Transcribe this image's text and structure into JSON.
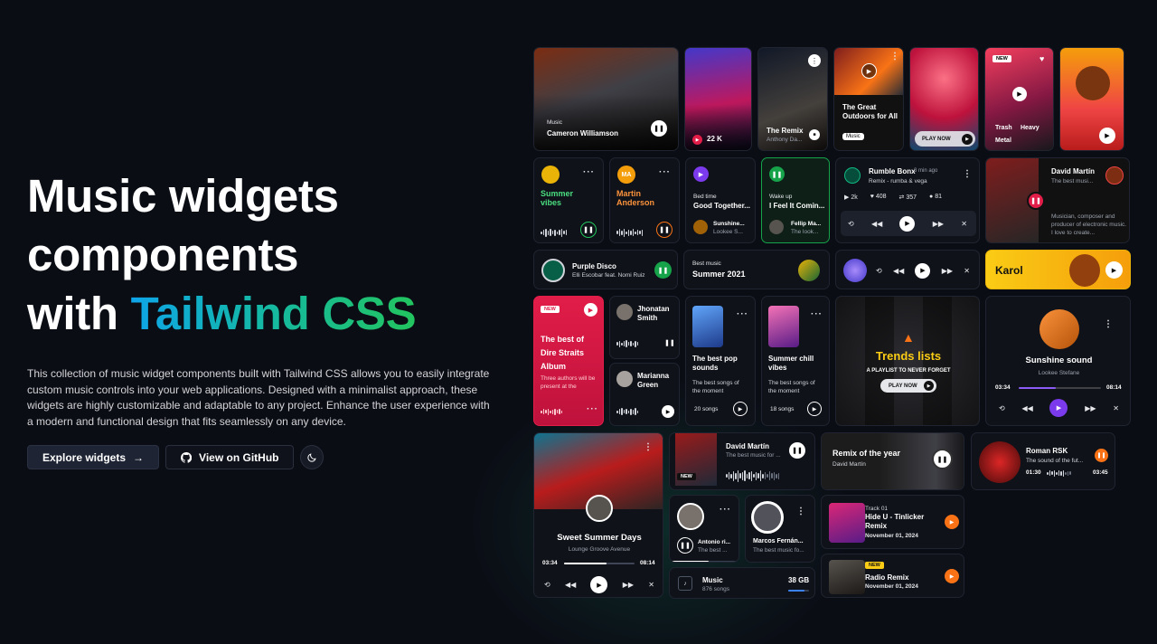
{
  "hero": {
    "line1": "Music widgets",
    "line2": "components",
    "line3_plain": "with ",
    "line3_grad": "Tailwind CSS",
    "description": "This collection of music widget components built with Tailwind CSS allows you to easily integrate custom music controls into your web applications. Designed with a minimalist approach, these widgets are highly customizable and adaptable to any project. Enhance the user experience with a modern and functional design that fits seamlessly on any device.",
    "explore_label": "Explore widgets",
    "explore_arrow": "→",
    "github_label": "View on GitHub",
    "icons": {
      "github": "github-icon",
      "theme": "moon-icon",
      "arrow": "arrow-right-icon"
    }
  },
  "widgets": {
    "cameron": {
      "label": "Music",
      "name": "Cameron Williamson"
    },
    "count22": {
      "value": "22 K"
    },
    "remix": {
      "title": "The Remix",
      "artist": "Anthony Da..."
    },
    "outdoors": {
      "title": "The Great Outdoors for All",
      "badge": "Music"
    },
    "playnow1": {
      "label": "PLAY NOW"
    },
    "trash": {
      "tag": "NEW",
      "w1": "Trash",
      "w2": "Heavy",
      "w3": "Metal"
    },
    "summer": {
      "title": "Summer vibes"
    },
    "martin": {
      "initials": "MA",
      "title": "Martin Anderson"
    },
    "bedtime": {
      "label": "Bed time",
      "title": "Good Together...",
      "artist": "Sunshine...",
      "sub": "Lookee S..."
    },
    "wakeup": {
      "label": "Wake up",
      "title": "I Feel It Comin...",
      "artist": "Fellip Ma...",
      "sub": "The look..."
    },
    "rumble": {
      "title": "Rumble Bonx",
      "time": "3 min ago",
      "sub": "Remix - rumba & vega",
      "plays": "2k",
      "likes": "408",
      "shares": "357",
      "comments": "81"
    },
    "davidCard": {
      "name": "David Martín",
      "sub": "The best musi...",
      "bio": "Musician, composer and producer of electronic music. I love to create..."
    },
    "purple": {
      "title": "Purple Disco",
      "sub": "Elli Escobar feat. Nomi Ruiz"
    },
    "best2021": {
      "label": "Best music",
      "title": "Summer 2021"
    },
    "karol": {
      "name": "Karol"
    },
    "direStraits": {
      "tag": "NEW",
      "title": "The best of Dire Straits Album",
      "sub": "Three authors will be present at the"
    },
    "jhonatan": {
      "name": "Jhonatan Smith"
    },
    "marianna": {
      "name": "Marianna Green"
    },
    "bestpop": {
      "title": "The best pop sounds",
      "sub": "The best songs of the moment",
      "count": "20 songs"
    },
    "chill": {
      "title": "Summer chill vibes",
      "sub": "The best songs of the moment",
      "count": "18 songs"
    },
    "trends": {
      "title": "Trends lists",
      "sub": "A PLAYLIST TO NEVER FORGET",
      "play": "PLAY NOW"
    },
    "sunshine": {
      "title": "Sunshine sound",
      "sub": "Lookee Stefane",
      "start": "03:34",
      "end": "08:14",
      "progress": 0.45
    },
    "sweet": {
      "title": "Sweet Summer Days",
      "sub": "Lounge Groove Avenue",
      "start": "03:34",
      "end": "08:14",
      "progress": 0.6
    },
    "davidWave": {
      "name": "David Martín",
      "sub": "The best music for ...",
      "tag": "NEW"
    },
    "remixYear": {
      "title": "Remix of the year",
      "artist": "David Martín"
    },
    "roman": {
      "name": "Roman RSK",
      "sub": "The sound of the fut...",
      "start": "01:30",
      "end": "03:45"
    },
    "antonio": {
      "name": "Antonio ri...",
      "sub": "The best ..."
    },
    "marcos": {
      "name": "Marcos Fernán...",
      "sub": "The best music fo..."
    },
    "storage": {
      "title": "Music",
      "sub": "876 songs",
      "size": "38 GB"
    },
    "track01": {
      "label": "Track 01",
      "title": "Hide U - Tinlicker Remix",
      "date": "November 01, 2024"
    },
    "radio": {
      "tag": "NEW",
      "title": "Radio Remix",
      "date": "November 01, 2024"
    }
  }
}
